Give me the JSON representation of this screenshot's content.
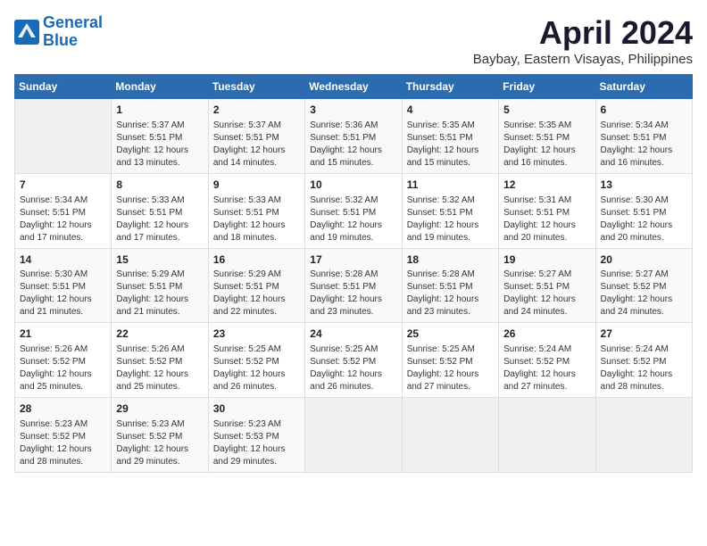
{
  "logo": {
    "line1": "General",
    "line2": "Blue"
  },
  "title": "April 2024",
  "location": "Baybay, Eastern Visayas, Philippines",
  "days_of_week": [
    "Sunday",
    "Monday",
    "Tuesday",
    "Wednesday",
    "Thursday",
    "Friday",
    "Saturday"
  ],
  "weeks": [
    [
      {
        "num": "",
        "info": ""
      },
      {
        "num": "1",
        "info": "Sunrise: 5:37 AM\nSunset: 5:51 PM\nDaylight: 12 hours\nand 13 minutes."
      },
      {
        "num": "2",
        "info": "Sunrise: 5:37 AM\nSunset: 5:51 PM\nDaylight: 12 hours\nand 14 minutes."
      },
      {
        "num": "3",
        "info": "Sunrise: 5:36 AM\nSunset: 5:51 PM\nDaylight: 12 hours\nand 15 minutes."
      },
      {
        "num": "4",
        "info": "Sunrise: 5:35 AM\nSunset: 5:51 PM\nDaylight: 12 hours\nand 15 minutes."
      },
      {
        "num": "5",
        "info": "Sunrise: 5:35 AM\nSunset: 5:51 PM\nDaylight: 12 hours\nand 16 minutes."
      },
      {
        "num": "6",
        "info": "Sunrise: 5:34 AM\nSunset: 5:51 PM\nDaylight: 12 hours\nand 16 minutes."
      }
    ],
    [
      {
        "num": "7",
        "info": "Sunrise: 5:34 AM\nSunset: 5:51 PM\nDaylight: 12 hours\nand 17 minutes."
      },
      {
        "num": "8",
        "info": "Sunrise: 5:33 AM\nSunset: 5:51 PM\nDaylight: 12 hours\nand 17 minutes."
      },
      {
        "num": "9",
        "info": "Sunrise: 5:33 AM\nSunset: 5:51 PM\nDaylight: 12 hours\nand 18 minutes."
      },
      {
        "num": "10",
        "info": "Sunrise: 5:32 AM\nSunset: 5:51 PM\nDaylight: 12 hours\nand 19 minutes."
      },
      {
        "num": "11",
        "info": "Sunrise: 5:32 AM\nSunset: 5:51 PM\nDaylight: 12 hours\nand 19 minutes."
      },
      {
        "num": "12",
        "info": "Sunrise: 5:31 AM\nSunset: 5:51 PM\nDaylight: 12 hours\nand 20 minutes."
      },
      {
        "num": "13",
        "info": "Sunrise: 5:30 AM\nSunset: 5:51 PM\nDaylight: 12 hours\nand 20 minutes."
      }
    ],
    [
      {
        "num": "14",
        "info": "Sunrise: 5:30 AM\nSunset: 5:51 PM\nDaylight: 12 hours\nand 21 minutes."
      },
      {
        "num": "15",
        "info": "Sunrise: 5:29 AM\nSunset: 5:51 PM\nDaylight: 12 hours\nand 21 minutes."
      },
      {
        "num": "16",
        "info": "Sunrise: 5:29 AM\nSunset: 5:51 PM\nDaylight: 12 hours\nand 22 minutes."
      },
      {
        "num": "17",
        "info": "Sunrise: 5:28 AM\nSunset: 5:51 PM\nDaylight: 12 hours\nand 23 minutes."
      },
      {
        "num": "18",
        "info": "Sunrise: 5:28 AM\nSunset: 5:51 PM\nDaylight: 12 hours\nand 23 minutes."
      },
      {
        "num": "19",
        "info": "Sunrise: 5:27 AM\nSunset: 5:51 PM\nDaylight: 12 hours\nand 24 minutes."
      },
      {
        "num": "20",
        "info": "Sunrise: 5:27 AM\nSunset: 5:52 PM\nDaylight: 12 hours\nand 24 minutes."
      }
    ],
    [
      {
        "num": "21",
        "info": "Sunrise: 5:26 AM\nSunset: 5:52 PM\nDaylight: 12 hours\nand 25 minutes."
      },
      {
        "num": "22",
        "info": "Sunrise: 5:26 AM\nSunset: 5:52 PM\nDaylight: 12 hours\nand 25 minutes."
      },
      {
        "num": "23",
        "info": "Sunrise: 5:25 AM\nSunset: 5:52 PM\nDaylight: 12 hours\nand 26 minutes."
      },
      {
        "num": "24",
        "info": "Sunrise: 5:25 AM\nSunset: 5:52 PM\nDaylight: 12 hours\nand 26 minutes."
      },
      {
        "num": "25",
        "info": "Sunrise: 5:25 AM\nSunset: 5:52 PM\nDaylight: 12 hours\nand 27 minutes."
      },
      {
        "num": "26",
        "info": "Sunrise: 5:24 AM\nSunset: 5:52 PM\nDaylight: 12 hours\nand 27 minutes."
      },
      {
        "num": "27",
        "info": "Sunrise: 5:24 AM\nSunset: 5:52 PM\nDaylight: 12 hours\nand 28 minutes."
      }
    ],
    [
      {
        "num": "28",
        "info": "Sunrise: 5:23 AM\nSunset: 5:52 PM\nDaylight: 12 hours\nand 28 minutes."
      },
      {
        "num": "29",
        "info": "Sunrise: 5:23 AM\nSunset: 5:52 PM\nDaylight: 12 hours\nand 29 minutes."
      },
      {
        "num": "30",
        "info": "Sunrise: 5:23 AM\nSunset: 5:53 PM\nDaylight: 12 hours\nand 29 minutes."
      },
      {
        "num": "",
        "info": ""
      },
      {
        "num": "",
        "info": ""
      },
      {
        "num": "",
        "info": ""
      },
      {
        "num": "",
        "info": ""
      }
    ]
  ]
}
